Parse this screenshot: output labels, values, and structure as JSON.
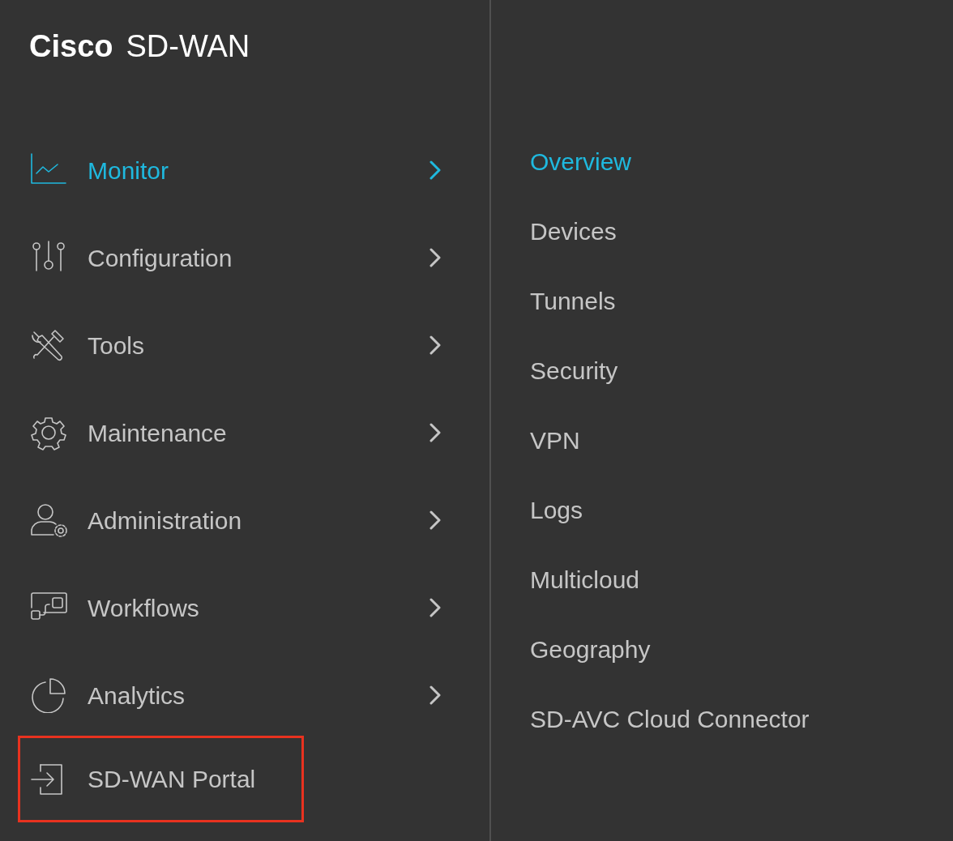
{
  "brand": {
    "name": "Cisco",
    "product": "SD-WAN"
  },
  "menu": [
    {
      "label": "Monitor",
      "kind": "submenu",
      "selected": true,
      "highlighted": false
    },
    {
      "label": "Configuration",
      "kind": "submenu",
      "selected": false,
      "highlighted": false
    },
    {
      "label": "Tools",
      "kind": "submenu",
      "selected": false,
      "highlighted": false
    },
    {
      "label": "Maintenance",
      "kind": "submenu",
      "selected": false,
      "highlighted": false
    },
    {
      "label": "Administration",
      "kind": "submenu",
      "selected": false,
      "highlighted": false
    },
    {
      "label": "Workflows",
      "kind": "submenu",
      "selected": false,
      "highlighted": false
    },
    {
      "label": "Analytics",
      "kind": "submenu",
      "selected": false,
      "highlighted": false
    },
    {
      "label": "SD-WAN Portal",
      "kind": "link",
      "selected": false,
      "highlighted": true
    }
  ],
  "submenu": [
    {
      "label": "Overview",
      "selected": true
    },
    {
      "label": "Devices",
      "selected": false
    },
    {
      "label": "Tunnels",
      "selected": false
    },
    {
      "label": "Security",
      "selected": false
    },
    {
      "label": "VPN",
      "selected": false
    },
    {
      "label": "Logs",
      "selected": false
    },
    {
      "label": "Multicloud",
      "selected": false
    },
    {
      "label": "Geography",
      "selected": false
    },
    {
      "label": "SD-AVC Cloud Connector",
      "selected": false
    }
  ]
}
